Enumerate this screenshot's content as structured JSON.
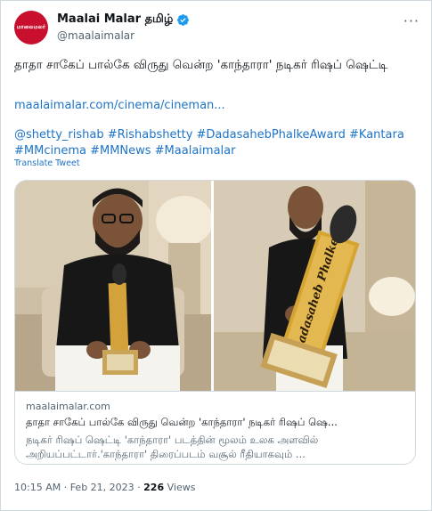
{
  "account": {
    "display_name": "Maalai Malar தமிழ்",
    "handle": "@maalaimalar",
    "avatar_text": "மாலைமலர்"
  },
  "tweet": {
    "text": "தாதா சாகேப் பால்கே விருது வென்ற 'காந்தாரா' நடிகர் ரிஷப் ஷெட்டி",
    "link": "maalaimalar.com/cinema/cineman...",
    "hashtags": "@shetty_rishab #Rishabshetty #DadasahebPhalkeAward #Kantara #MMcinema #MMNews #Maalaimalar",
    "translate": "Translate Tweet"
  },
  "card": {
    "domain": "maalaimalar.com",
    "title": "தாதா சாகேப் பால்கே விருது வென்ற 'காந்தாரா' நடிகர் ரிஷப் ஷெ...",
    "description": "நடிகர் ரிஷப் ஷெட்டி 'காந்தாரா' படத்தின் மூலம் உலக அளவில் அறியப்பட்டார்.'காந்தாரா' திரைப்படம் வசூல் ரீதியாகவும் ...",
    "award_text": "Dadasaheb Phalke"
  },
  "meta": {
    "time": "10:15 AM · Feb 21, 2023 ·",
    "views_count": "226",
    "views_label": "Views"
  },
  "colors": {
    "link": "#1d74c9",
    "verified": "#1d9bf0",
    "avatar": "#c8102e"
  }
}
